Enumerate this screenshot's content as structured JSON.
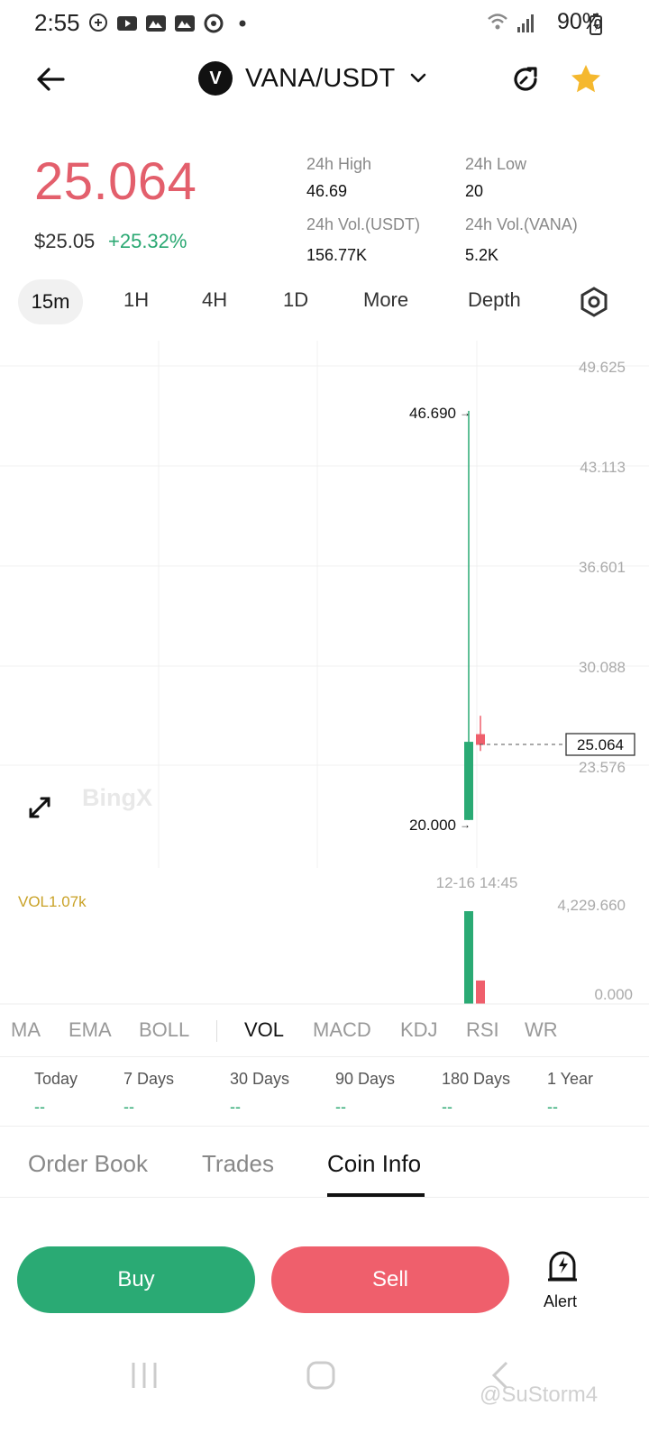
{
  "status_bar": {
    "time": "2:55",
    "battery": "90%"
  },
  "header": {
    "pair": "VANA/USDT",
    "logo_letter": "V"
  },
  "price": {
    "last": "25.064",
    "usd": "$25.05",
    "change": "+25.32%",
    "stats": [
      {
        "label": "24h High",
        "value": "46.69"
      },
      {
        "label": "24h Low",
        "value": "20"
      },
      {
        "label": "24h Vol.(USDT)",
        "value": "156.77K"
      },
      {
        "label": "24h Vol.(VANA)",
        "value": "5.2K"
      }
    ]
  },
  "intervals": {
    "active": "15m",
    "items": [
      "1H",
      "4H",
      "1D",
      "More",
      "Depth"
    ]
  },
  "chart": {
    "y_labels": [
      "49.625",
      "43.113",
      "36.601",
      "30.088",
      "23.576"
    ],
    "high_label": "46.690",
    "low_label": "20.000",
    "current_price_tag": "25.064",
    "time_label": "12-16 14:45",
    "watermark": "BingX",
    "vol_title": "VOL1.07k",
    "vol_axis_top": "4,229.660",
    "vol_axis_bottom": "0.000"
  },
  "chart_data": {
    "type": "candlestick",
    "y_axis_range": [
      20.0,
      50.0
    ],
    "candles": [
      {
        "open": 20.0,
        "high": 46.69,
        "low": 20.0,
        "close": 25.1,
        "direction": "up"
      },
      {
        "open": 25.6,
        "high": 26.8,
        "low": 24.5,
        "close": 24.9,
        "direction": "down"
      }
    ],
    "volume": [
      4229.66,
      1070
    ]
  },
  "indicators": {
    "items": [
      "MA",
      "EMA",
      "BOLL",
      "VOL",
      "MACD",
      "KDJ",
      "RSI",
      "WR"
    ],
    "active": "VOL"
  },
  "returns": [
    {
      "label": "Today",
      "value": "--"
    },
    {
      "label": "7 Days",
      "value": "--"
    },
    {
      "label": "30 Days",
      "value": "--"
    },
    {
      "label": "90 Days",
      "value": "--"
    },
    {
      "label": "180 Days",
      "value": "--"
    },
    {
      "label": "1 Year",
      "value": "--"
    }
  ],
  "bottom_tabs": [
    "Order Book",
    "Trades",
    "Coin Info"
  ],
  "actions": {
    "buy": "Buy",
    "sell": "Sell",
    "alert": "Alert"
  },
  "watermark": "@SuStorm4",
  "colors": {
    "up": "#2aaa74",
    "down": "#ef5f6c",
    "price": "#e35f6c",
    "vol_title": "#c9a227"
  }
}
